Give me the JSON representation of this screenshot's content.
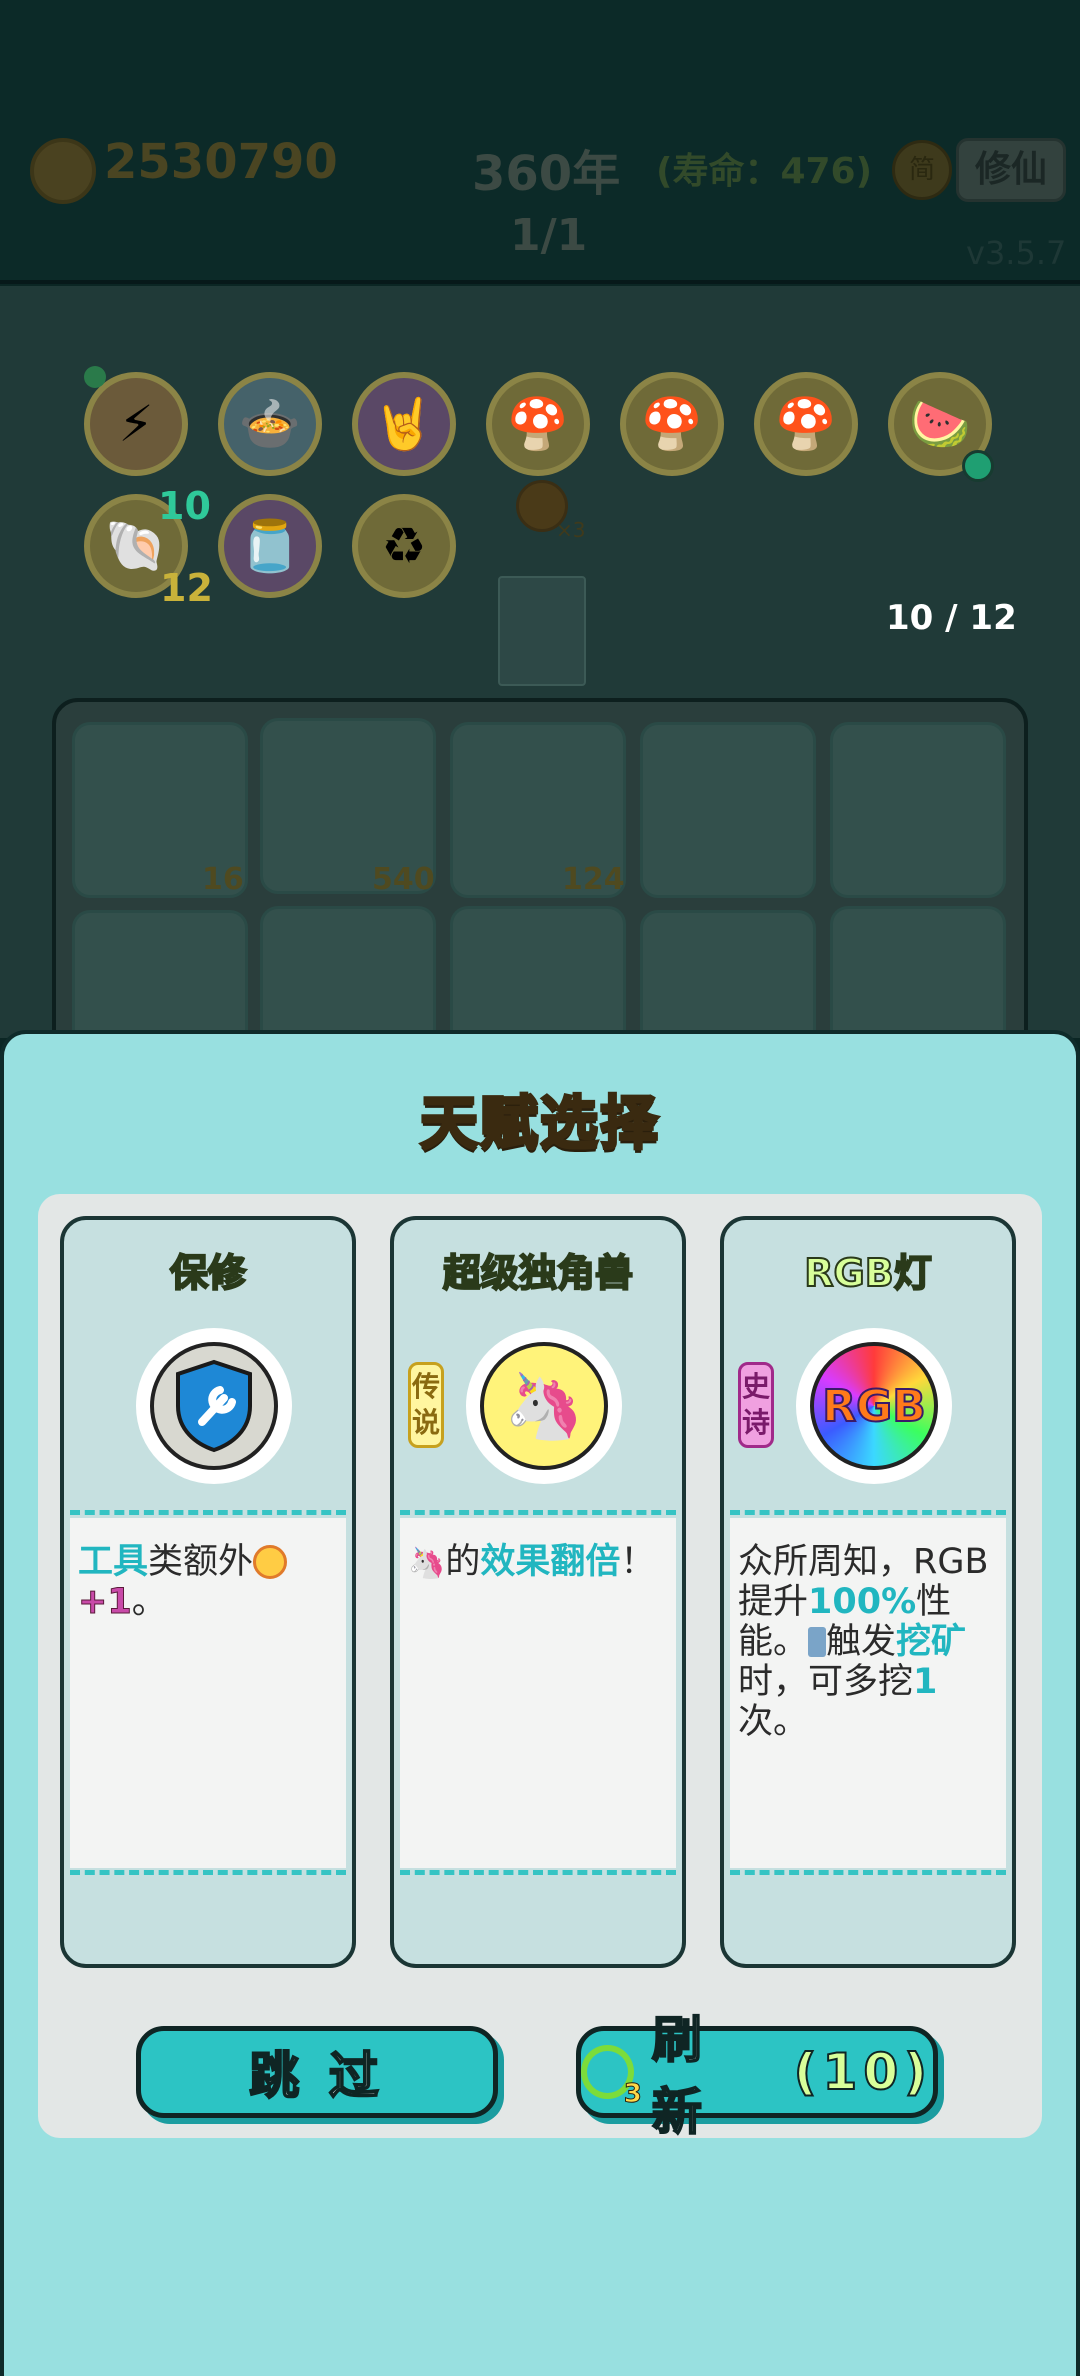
{
  "header": {
    "coins": "2530790",
    "year": "360年",
    "lifespan": "(寿命：476)",
    "page": "1/1",
    "version": "v3.5.7",
    "simplified_label": "简",
    "cultivate_label": "修仙"
  },
  "board": {
    "relic_counts": {
      "lightning_extra": "10",
      "shell_count": "12"
    },
    "multiplier": "×3",
    "slot_counter": "10 / 12",
    "cell_values": [
      "16",
      "540",
      "124"
    ]
  },
  "dialog": {
    "title": "天赋选择",
    "cards": [
      {
        "name": "保修",
        "icon": "shield-wrench-icon",
        "rarity": "",
        "desc_parts": [
          "工具",
          "类额外",
          "+1",
          "。"
        ]
      },
      {
        "name": "超级独角兽",
        "icon": "unicorn-icon",
        "rarity": "传说",
        "desc_parts": [
          "的",
          "效果翻倍",
          "！"
        ]
      },
      {
        "name": "RGB灯",
        "icon": "rgb-lamp-icon",
        "rarity": "史诗",
        "icon_text": "RGB",
        "desc_parts": [
          "众所周知，RGB提升",
          "100%",
          "性能。",
          "触发",
          "挖矿",
          "时，可多挖",
          "1",
          "次。"
        ]
      }
    ],
    "skip_label": "跳 过",
    "refresh_label": "刷 新",
    "refresh_count": "(10)",
    "refresh_badge": "3"
  },
  "colors": {
    "dialog_bg": "#98e0e0",
    "highlight": "#21b6c0",
    "button": "#2cc4c4",
    "title_yellow": "#ffd84a"
  }
}
